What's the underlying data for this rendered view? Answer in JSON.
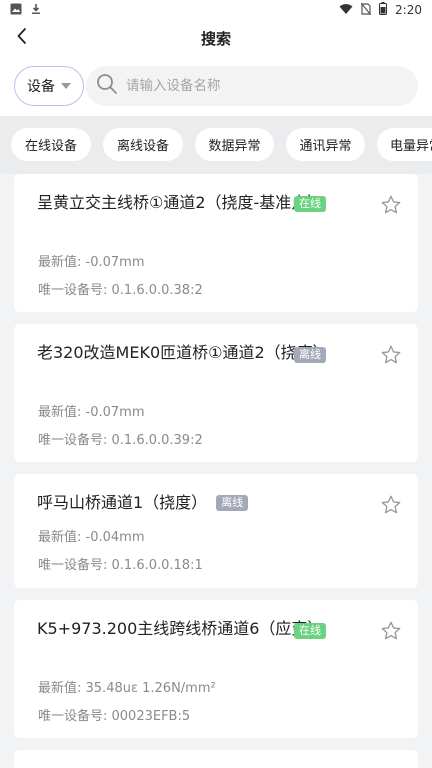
{
  "status_bar": {
    "time": "2:20",
    "left_icons": [
      "image-icon",
      "download-icon"
    ],
    "right_icons": [
      "wifi-icon",
      "no-sim-icon",
      "battery-icon"
    ]
  },
  "header": {
    "title": "搜索",
    "back_icon": "chevron-left-icon"
  },
  "search": {
    "dropdown_label": "设备",
    "placeholder": "请输入设备名称",
    "value": ""
  },
  "filters": [
    {
      "label": "在线设备"
    },
    {
      "label": "离线设备"
    },
    {
      "label": "数据异常"
    },
    {
      "label": "通讯异常"
    },
    {
      "label": "电量异常"
    }
  ],
  "labels": {
    "latest_value": "最新值: ",
    "unique_id": "唯一设备号: "
  },
  "devices": [
    {
      "name": "呈黄立交主线桥①通道2（挠度-基准点）",
      "status": "在线",
      "latest": "-0.07mm",
      "uid": "0.1.6.0.0.38:2"
    },
    {
      "name": "老320改造MEK0匝道桥①通道2（挠度）",
      "status": "离线",
      "latest": "-0.07mm",
      "uid": "0.1.6.0.0.39:2"
    },
    {
      "name": "呼马山桥通道1（挠度）",
      "status": "离线",
      "latest": "-0.04mm",
      "uid": "0.1.6.0.0.18:1"
    },
    {
      "name": "K5+973.200主线跨线桥通道6（应变）",
      "status": "在线",
      "latest": "35.48uε 1.26N/mm²",
      "uid": "00023EFB:5"
    }
  ],
  "colors": {
    "online": "#6ad281",
    "offline": "#a4a9b8",
    "dropdown_border": "#b9c3ea"
  }
}
